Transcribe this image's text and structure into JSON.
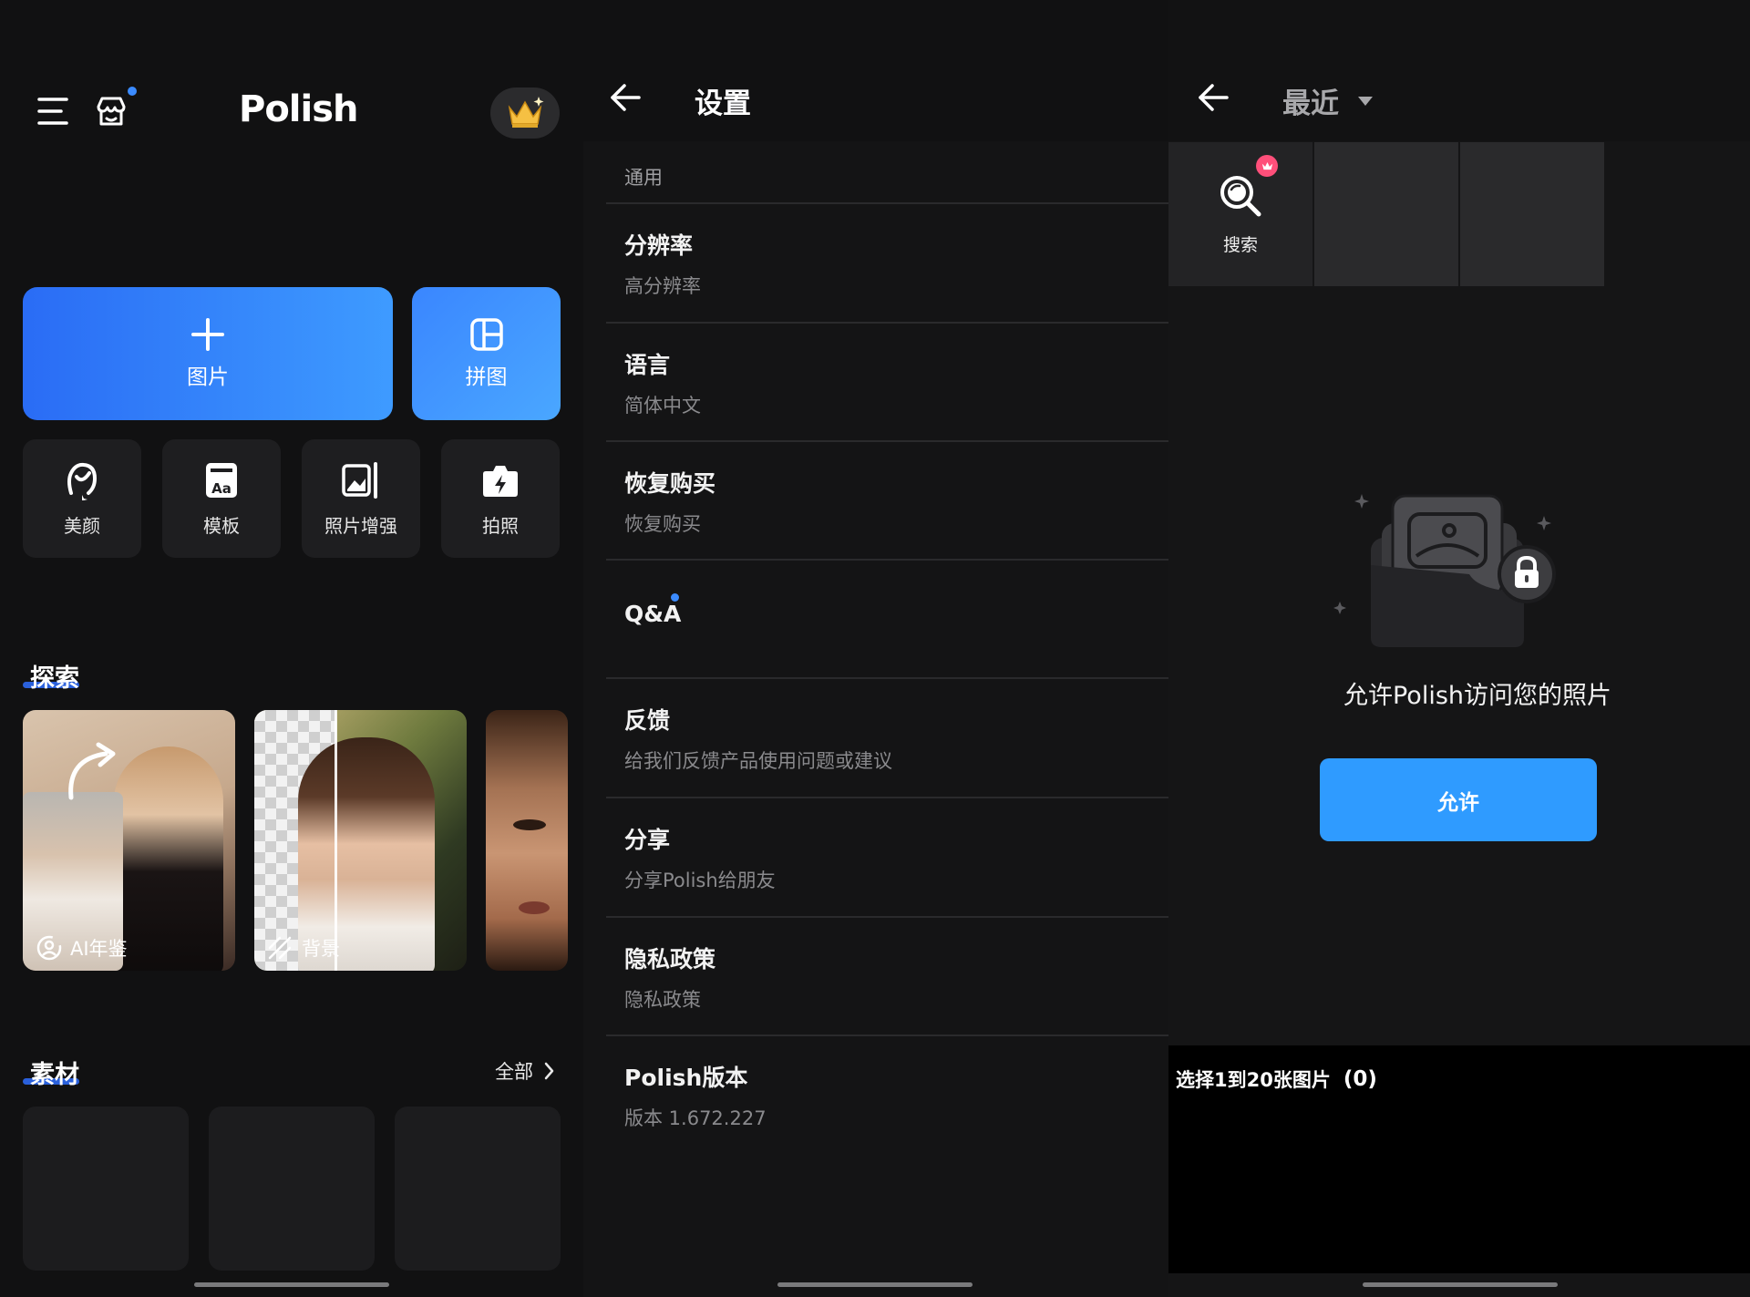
{
  "home": {
    "app_title": "Polish",
    "menu_icon": "menu-icon",
    "store_icon": "store-icon",
    "premium_icon": "crown-icon",
    "photo_button": "图片",
    "collage_button": "拼图",
    "tools": [
      {
        "label": "美颜",
        "icon": "face-retouch-icon"
      },
      {
        "label": "模板",
        "icon": "template-icon"
      },
      {
        "label": "照片增强",
        "icon": "enhance-icon"
      },
      {
        "label": "拍照",
        "icon": "camera-icon"
      }
    ],
    "explore_title": "探索",
    "explore_cards": [
      {
        "label": "AI年鉴",
        "icon": "ai-face-icon"
      },
      {
        "label": "背景",
        "icon": "background-icon"
      },
      {
        "label": "",
        "icon": ""
      }
    ],
    "materials_title": "素材",
    "materials_all": "全部",
    "accent_color": "#2f7bff"
  },
  "settings": {
    "title": "设置",
    "group_general": "通用",
    "items": [
      {
        "title": "分辨率",
        "subtitle": "高分辨率"
      },
      {
        "title": "语言",
        "subtitle": "简体中文"
      },
      {
        "title": "恢复购买",
        "subtitle": "恢复购买"
      },
      {
        "title": "Q&A",
        "subtitle": ""
      },
      {
        "title": "反馈",
        "subtitle": "给我们反馈产品使用问题或建议"
      },
      {
        "title": "分享",
        "subtitle": "分享Polish给朋友"
      },
      {
        "title": "隐私政策",
        "subtitle": "隐私政策"
      },
      {
        "title": "Polish版本",
        "subtitle": "版本 1.672.227"
      }
    ]
  },
  "picker": {
    "album_title": "最近",
    "search_label": "搜索",
    "permission_text": "允许Polish访问您的照片",
    "allow_button": "允许",
    "selection_text": "选择1到20张图片",
    "selection_count": "(0)",
    "button_color": "#2f9bff"
  }
}
